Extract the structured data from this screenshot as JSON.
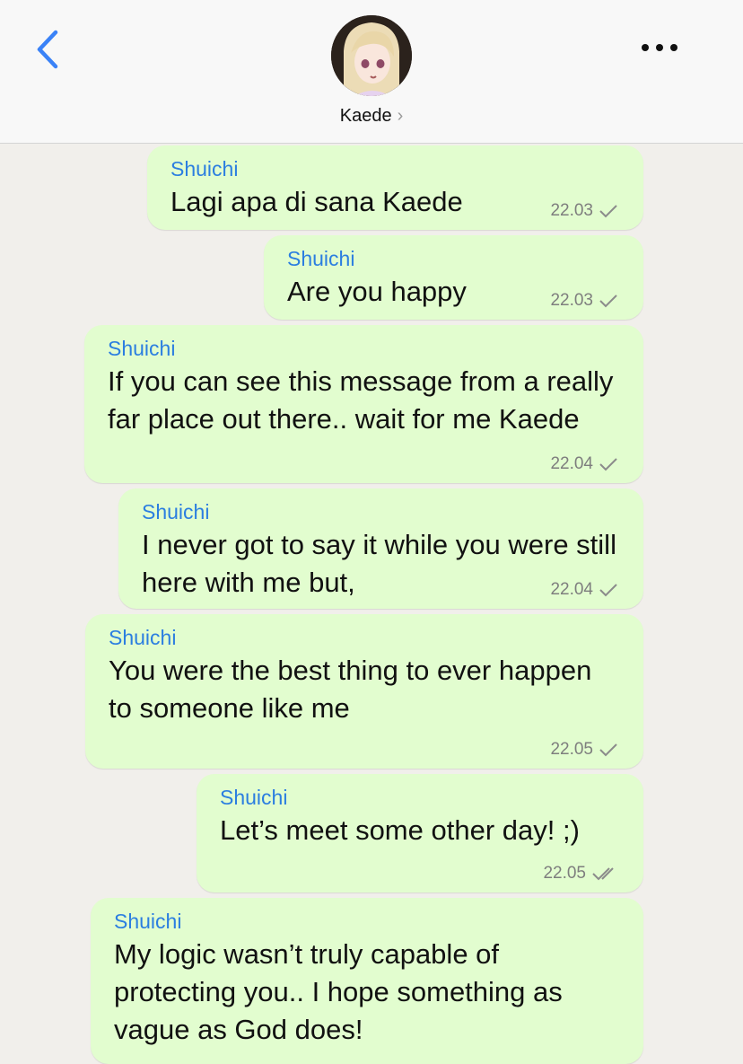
{
  "header": {
    "contact_name": "Kaede",
    "chevron": "›",
    "back_icon": "chevron-left-icon",
    "more_icon": "more-horizontal-icon",
    "accent_color": "#3a82f7"
  },
  "messages": [
    {
      "sender": "Shuichi",
      "text": "Lagi apa di sana Kaede",
      "time": "22.03",
      "status": "sent"
    },
    {
      "sender": "Shuichi",
      "text": "Are you happy",
      "time": "22.03",
      "status": "sent"
    },
    {
      "sender": "Shuichi",
      "text": "If you can see this message from a really far place out there.. wait for me Kaede",
      "time": "22.04",
      "status": "sent"
    },
    {
      "sender": "Shuichi",
      "text": "I never got to say it while you were still here with me but,",
      "time": "22.04",
      "status": "sent"
    },
    {
      "sender": "Shuichi",
      "text": "You were the best thing to ever happen to someone like me",
      "time": "22.05",
      "status": "sent"
    },
    {
      "sender": "Shuichi",
      "text": "Let’s meet some other day! ;)",
      "time": "22.05",
      "status": "delivered"
    },
    {
      "sender": "Shuichi",
      "text": "My logic wasn’t truly capable of protecting you.. I hope something as vague as God does!",
      "time": "",
      "status": ""
    }
  ],
  "colors": {
    "background": "#f1efeb",
    "bubble": "#e2fdcf",
    "sender_name": "#2b7ee0",
    "timestamp": "#7e7e7e"
  }
}
